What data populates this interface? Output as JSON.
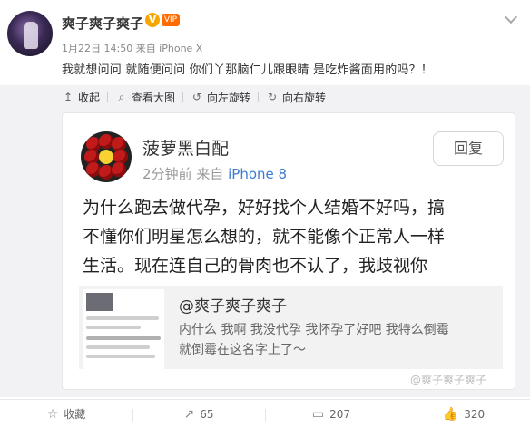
{
  "post": {
    "username": "爽子爽子爽子",
    "verified_badge": "V",
    "vip_label": "VIP",
    "meta": "1月22日 14:50 来自 iPhone X",
    "text": "我就想问问 就随便问问 你们丫那脑仁儿跟眼睛 是吃炸酱面用的吗？！",
    "menu_icon": "chevron-down-icon"
  },
  "image_toolbar": {
    "items": [
      {
        "icon": "collapse-icon",
        "label": "收起"
      },
      {
        "icon": "zoom-icon",
        "label": "查看大图"
      },
      {
        "icon": "rotate-left-icon",
        "label": "向左旋转"
      },
      {
        "icon": "rotate-right-icon",
        "label": "向右旋转"
      }
    ]
  },
  "screenshot_card": {
    "name": "菠萝黑白配",
    "meta_time": "2分钟前",
    "meta_from": "来自",
    "meta_device": "iPhone 8",
    "reply_label": "回复",
    "body_lines": [
      "为什么跑去做代孕，好好找个人结婚不好吗，搞",
      "不懂你们明星怎么想的，就不能像个正常人一样",
      "生活。现在连自己的骨肉也不认了，我歧视你"
    ],
    "quote": {
      "user": "@爽子爽子爽子",
      "text_lines": [
        "内什么 我啊 我没代孕 我怀孕了好吧 我特么倒霉",
        "就倒霉在这名字上了～"
      ]
    }
  },
  "watermark": "@爽子爽子爽子",
  "bottom_bar": {
    "favorite": {
      "icon": "star-icon",
      "label": "收藏"
    },
    "repost": {
      "icon": "repost-icon",
      "count": "65"
    },
    "comment": {
      "icon": "comment-icon",
      "count": "207"
    },
    "like": {
      "icon": "thumbs-up-icon",
      "count": "320"
    }
  }
}
